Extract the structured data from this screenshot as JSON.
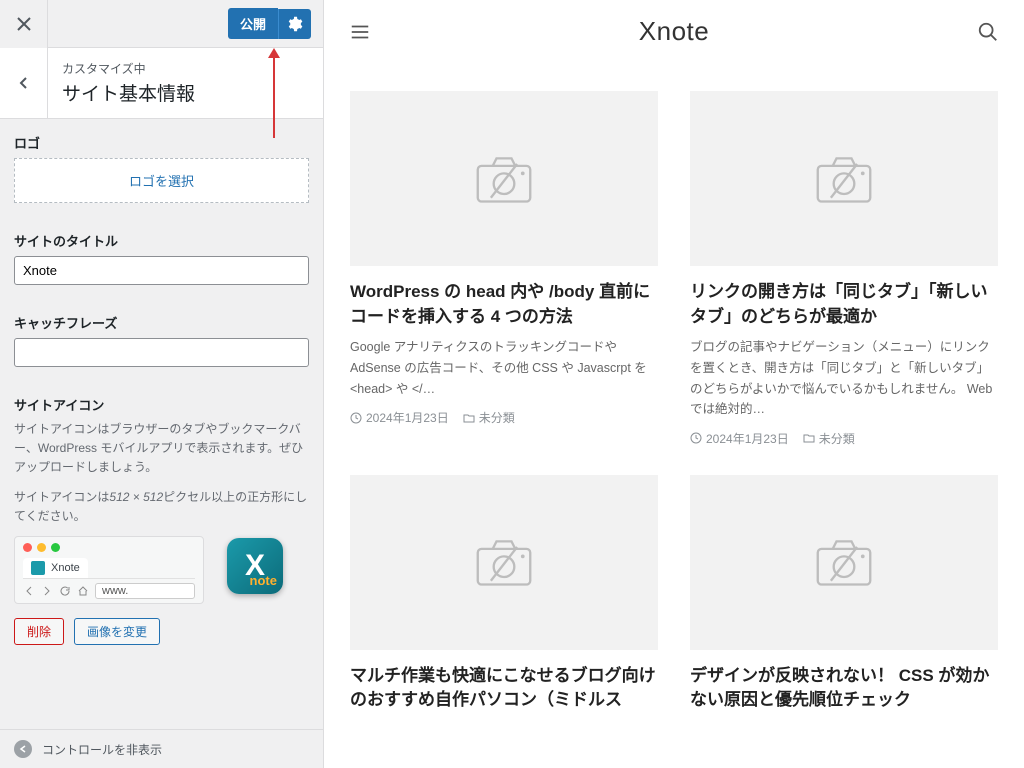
{
  "panel": {
    "publish_label": "公開",
    "customizing_label": "カスタマイズ中",
    "section_title": "サイト基本情報",
    "logo_heading": "ロゴ",
    "logo_select_label": "ロゴを選択",
    "site_title_label": "サイトのタイトル",
    "site_title_value": "Xnote",
    "tagline_label": "キャッチフレーズ",
    "tagline_value": "",
    "site_icon_heading": "サイトアイコン",
    "site_icon_desc1": "サイトアイコンはブラウザーのタブやブックマークバー、WordPress モバイルアプリで表示されます。ぜひアップロードしましょう。",
    "site_icon_desc2_a": "サイトアイコンは",
    "site_icon_desc2_b": "512 × 512",
    "site_icon_desc2_c": "ピクセル以上の正方形にしてください。",
    "browser_tab_label": "Xnote",
    "browser_addr": "www.",
    "app_icon_big": "X",
    "app_icon_small": "note",
    "remove_label": "削除",
    "change_image_label": "画像を変更",
    "hide_controls_label": "コントロールを非表示"
  },
  "site": {
    "title": "Xnote",
    "posts": [
      {
        "title": "WordPress の head 内や /body 直前にコードを挿入する 4 つの方法",
        "excerpt": "Google アナリティクスのトラッキングコードや AdSense の広告コード、その他 CSS や Javascrpt を <head> や </…",
        "date": "2024年1月23日",
        "category": "未分類"
      },
      {
        "title": "リンクの開き方は「同じタブ」「新しいタブ」のどちらが最適か",
        "excerpt": "ブログの記事やナビゲーション（メニュー）にリンクを置くとき、開き方は「同じタブ」と「新しいタブ」のどちらがよいかで悩んでいるかもしれません。 Web では絶対的…",
        "date": "2024年1月23日",
        "category": "未分類"
      },
      {
        "title": "マルチ作業も快適にこなせるブログ向けのおすすめ自作パソコン（ミドルス",
        "excerpt": "",
        "date": "",
        "category": ""
      },
      {
        "title": "デザインが反映されない！ CSS が効かない原因と優先順位チェック",
        "excerpt": "",
        "date": "",
        "category": ""
      }
    ]
  }
}
